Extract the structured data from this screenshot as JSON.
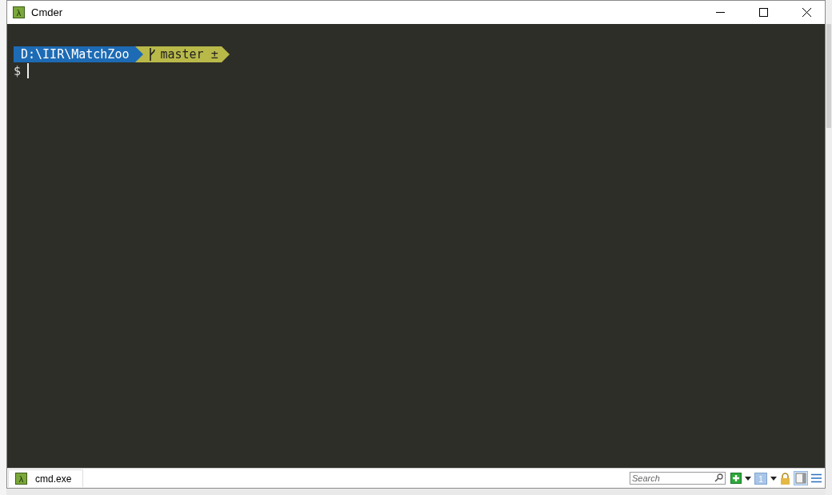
{
  "window": {
    "title": "Cmder",
    "logo": "λ"
  },
  "prompt": {
    "path": "D:\\IIR\\MatchZoo",
    "branch": "master ±",
    "symbol": "$"
  },
  "tabs": [
    {
      "label": "cmd.exe",
      "icon": "λ",
      "selected": true
    }
  ],
  "search": {
    "placeholder": "Search"
  },
  "toolbar": {
    "console_number": "1"
  }
}
